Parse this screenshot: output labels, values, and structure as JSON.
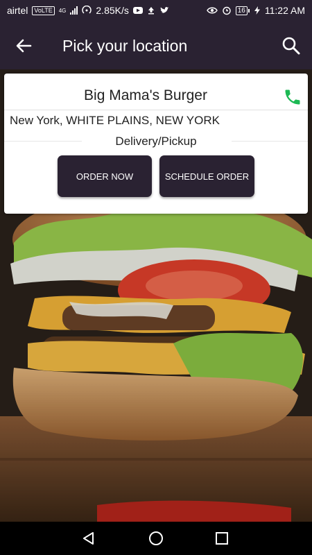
{
  "status_bar": {
    "carrier": "airtel",
    "volte": "VoLTE",
    "network": "4G",
    "speed": "2.85K/s",
    "battery": "16",
    "time": "11:22 AM"
  },
  "app_bar": {
    "title": "Pick your location"
  },
  "restaurant": {
    "name": "Big Mama's Burger",
    "address": "New York, WHITE PLAINS, NEW YORK",
    "mode": "Delivery/Pickup"
  },
  "buttons": {
    "order_now": "ORDER NOW",
    "schedule_order": "SCHEDULE ORDER"
  },
  "colors": {
    "primary": "#2a2232",
    "phone_icon": "#1db954",
    "card_bg": "#ffffff"
  },
  "icons": {
    "back": "arrow-left",
    "search": "magnifier",
    "phone": "phone",
    "nav_back": "triangle-back",
    "nav_home": "circle-home",
    "nav_recents": "square-recents"
  }
}
